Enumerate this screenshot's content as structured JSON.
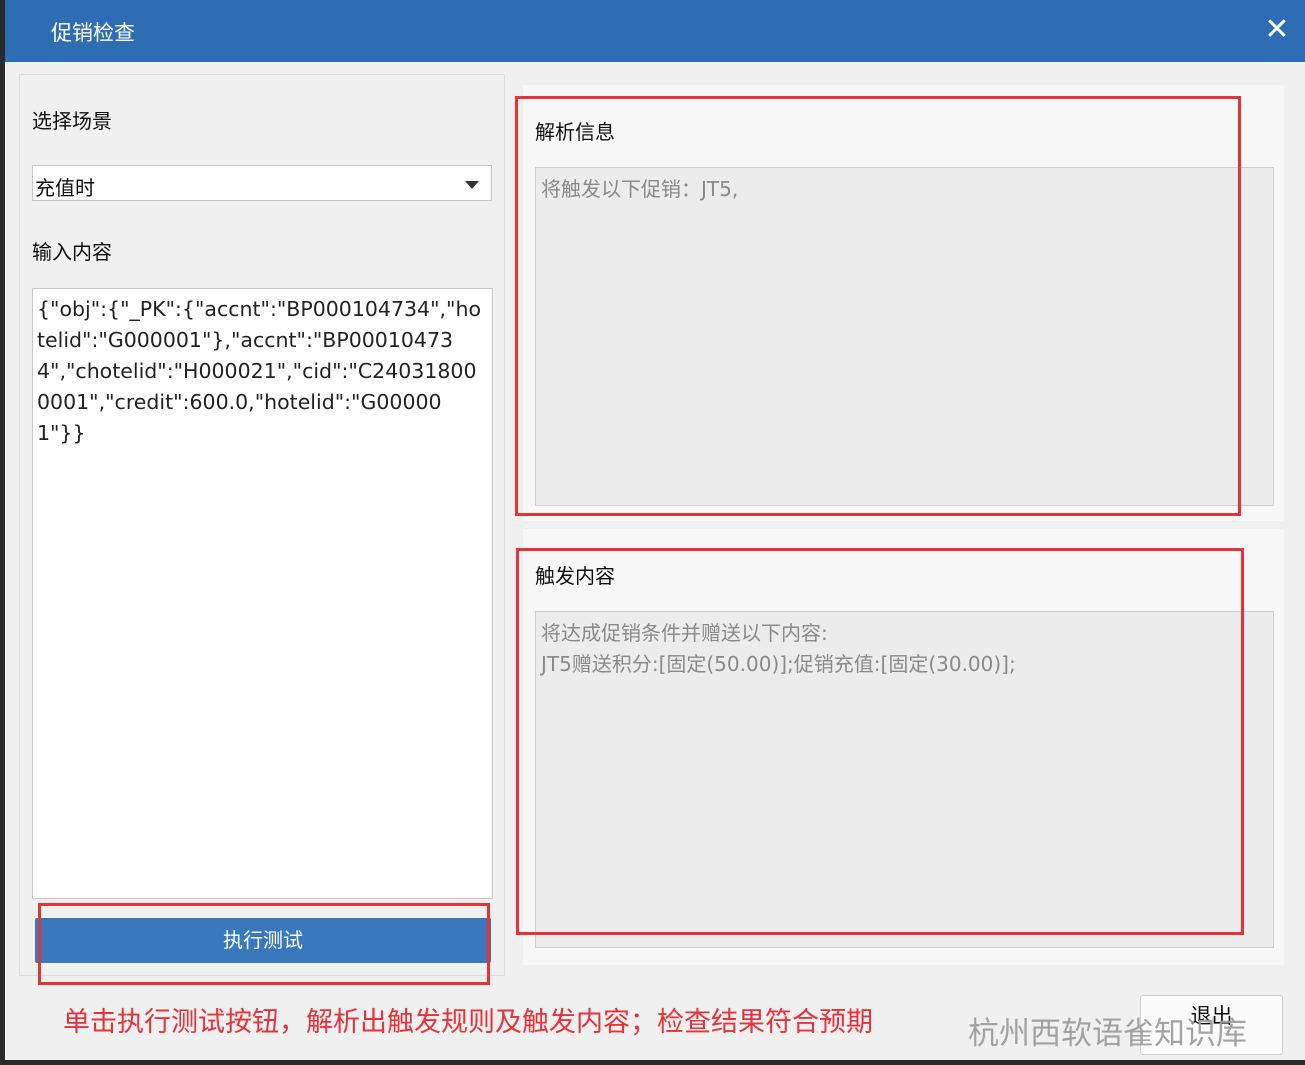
{
  "window": {
    "title": "促销检查",
    "close_glyph": "✕"
  },
  "left": {
    "scene_label": "选择场景",
    "scene_selected": "充值时",
    "input_label": "输入内容",
    "input_value": "{\"obj\":{\"_PK\":{\"accnt\":\"BP000104734\",\"hotelid\":\"G000001\"},\"accnt\":\"BP000104734\",\"chotelid\":\"H000021\",\"cid\":\"C240318000001\",\"credit\":600.0,\"hotelid\":\"G000001\"}}",
    "run_button": "执行测试"
  },
  "parse_info": {
    "title": "解析信息",
    "text": "将触发以下促销：JT5,"
  },
  "trigger_content": {
    "title": "触发内容",
    "line1": "将达成促销条件并赠送以下内容:",
    "line2": "JT5赠送积分:[固定(50.00)];促销充值:[固定(30.00)];"
  },
  "footer": {
    "annotation": "单击执行测试按钮，解析出触发规则及触发内容；检查结果符合预期",
    "exit_button": "退出",
    "watermark": "杭州西软语雀知识库"
  },
  "colors": {
    "titlebar": "#2e6db4",
    "primary_button": "#3a78bd",
    "annotation_red": "#e8323a"
  }
}
